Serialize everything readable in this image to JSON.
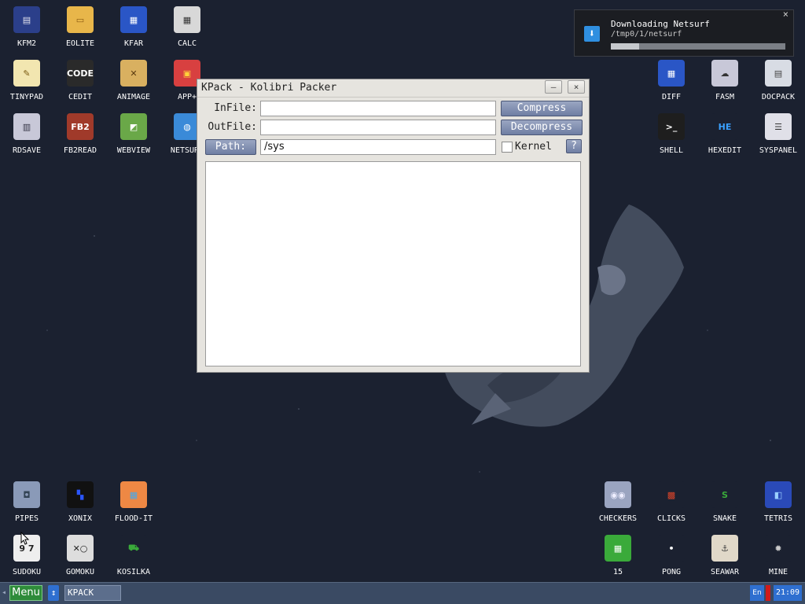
{
  "desktop": {
    "icons": [
      {
        "label": "KFM2",
        "icon": "floppy-icon"
      },
      {
        "label": "EOLITE",
        "icon": "folder-icon"
      },
      {
        "label": "KFAR",
        "icon": "file-manager-icon"
      },
      {
        "label": "CALC",
        "icon": "calculator-icon"
      },
      {
        "label": "TINYPAD",
        "icon": "notepad-icon"
      },
      {
        "label": "CEDIT",
        "icon": "code-icon"
      },
      {
        "label": "ANIMAGE",
        "icon": "paint-icon"
      },
      {
        "label": "APP+",
        "icon": "cube-icon"
      },
      {
        "label": "RDSAVE",
        "icon": "ram-disk-icon"
      },
      {
        "label": "FB2READ",
        "icon": "book-icon"
      },
      {
        "label": "WEBVIEW",
        "icon": "web-icon"
      },
      {
        "label": "NETSURF",
        "icon": "globe-icon"
      },
      {
        "label": "DIFF",
        "icon": "diff-icon"
      },
      {
        "label": "FASM",
        "icon": "assembler-icon"
      },
      {
        "label": "DOCPACK",
        "icon": "docpack-icon"
      },
      {
        "label": "SHELL",
        "icon": "terminal-icon"
      },
      {
        "label": "HEXEDIT",
        "icon": "hex-icon"
      },
      {
        "label": "SYSPANEL",
        "icon": "sliders-icon"
      },
      {
        "label": "PIPES",
        "icon": "pipes-icon"
      },
      {
        "label": "XONIX",
        "icon": "xonix-icon"
      },
      {
        "label": "FLOOD-IT",
        "icon": "flood-icon"
      },
      {
        "label": "SUDOKU",
        "icon": "sudoku-icon"
      },
      {
        "label": "GOMOKU",
        "icon": "gomoku-icon"
      },
      {
        "label": "KOSILKA",
        "icon": "lawnmower-icon"
      },
      {
        "label": "CHECKERS",
        "icon": "checkers-icon"
      },
      {
        "label": "CLICKS",
        "icon": "clicks-icon"
      },
      {
        "label": "SNAKE",
        "icon": "snake-icon"
      },
      {
        "label": "TETRIS",
        "icon": "tetris-icon"
      },
      {
        "label": "15",
        "icon": "fifteen-icon"
      },
      {
        "label": "PONG",
        "icon": "pong-icon"
      },
      {
        "label": "SEAWAR",
        "icon": "seawar-icon"
      },
      {
        "label": "MINE",
        "icon": "mine-icon"
      }
    ]
  },
  "notification": {
    "title": "Downloading Netsurf",
    "path": "/tmp0/1/netsurf",
    "close": "×",
    "progress": 0.16
  },
  "window": {
    "title": "KPack - Kolibri Packer",
    "minimize": "–",
    "close": "×",
    "infile_label": "InFile:",
    "infile_value": "",
    "outfile_label": "OutFile:",
    "outfile_value": "",
    "path_button": "Path:",
    "path_value": "/sys",
    "compress_button": "Compress",
    "decompress_button": "Decompress",
    "kernel_label": "Kernel",
    "kernel_checked": false,
    "help_button": "?"
  },
  "taskbar": {
    "menu": "Menu",
    "switch": "↕",
    "task": "KPACK",
    "lang": "En",
    "clock": "21:09",
    "arrow": "◂"
  }
}
